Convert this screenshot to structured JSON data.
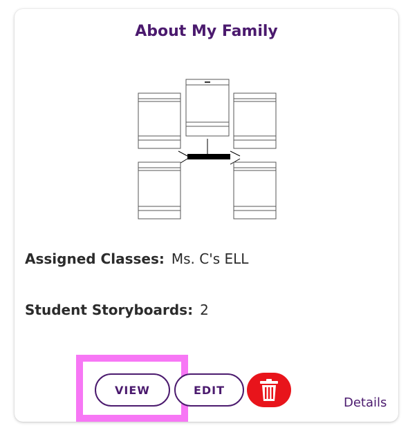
{
  "card": {
    "title": "About My Family",
    "assigned_classes_label": "Assigned Classes:",
    "assigned_classes_value": "Ms. C's ELL",
    "student_storyboards_label": "Student Storyboards:",
    "student_storyboards_value": "2"
  },
  "actions": {
    "view_label": "VIEW",
    "edit_label": "EDIT",
    "delete_icon": "trash-icon",
    "details_label": "Details"
  },
  "colors": {
    "brand_purple": "#4b1a6e",
    "delete_red": "#e8141b",
    "highlight_pink": "#f777f5"
  }
}
